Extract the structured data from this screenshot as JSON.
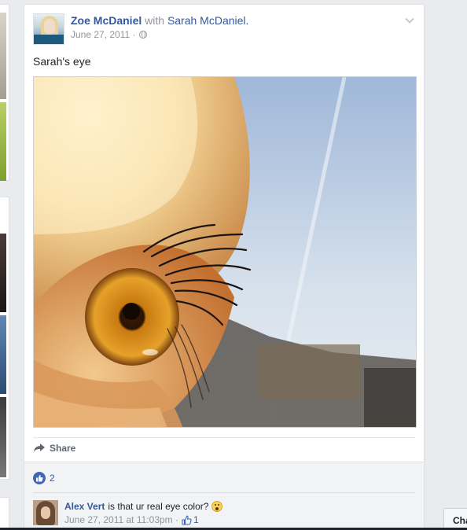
{
  "post": {
    "author": "Zoe McDaniel",
    "with_word": "with",
    "tagged": "Sarah McDaniel.",
    "date": "June 27, 2011 · ",
    "caption": "Sarah's eye",
    "photo_icon": "photo-eye-closeup"
  },
  "actions": {
    "share_label": "Share"
  },
  "reactions": {
    "like_count": "2"
  },
  "comment": {
    "author": "Alex Vert",
    "text": "is that ur real eye color?",
    "emoji_icon": "surprised-emoji-icon",
    "meta": "June 27, 2011 at 11:03pm · ",
    "like_count": "1"
  },
  "chat": {
    "label": "Chat"
  },
  "colors": {
    "link": "#365899",
    "muted": "#90949c",
    "accent": "#4267b2",
    "page_bg": "#e9ebee"
  }
}
